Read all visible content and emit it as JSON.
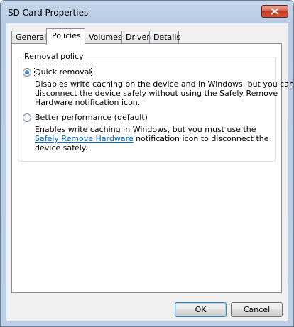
{
  "window": {
    "title": "SD Card Properties"
  },
  "tabs": [
    {
      "label": "General",
      "active": false
    },
    {
      "label": "Policies",
      "active": true
    },
    {
      "label": "Volumes",
      "active": false
    },
    {
      "label": "Driver",
      "active": false
    },
    {
      "label": "Details",
      "active": false
    }
  ],
  "removal_policy": {
    "group_label": "Removal policy",
    "options": [
      {
        "label": "Quick removal",
        "checked": true,
        "description_lines": [
          "Disables write caching on the device and in Windows, but you can",
          "disconnect the device safely without using the Safely Remove",
          "Hardware notification icon."
        ]
      },
      {
        "label": "Better performance (default)",
        "checked": false,
        "description_line1": "Enables write caching in Windows, but you must use the",
        "link_text": "Safely Remove Hardware",
        "description_line2_rest": " notification icon to disconnect the",
        "description_line3": "device safely."
      }
    ]
  },
  "buttons": {
    "ok": "OK",
    "cancel": "Cancel"
  },
  "colors": {
    "link": "#0066cc",
    "close_button": "#c1381f"
  }
}
